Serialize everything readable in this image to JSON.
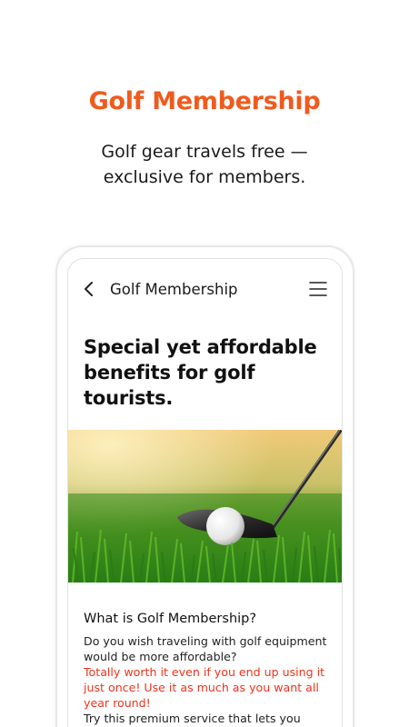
{
  "promo": {
    "title": "Golf Membership",
    "subtitle_line1": "Golf gear travels free —",
    "subtitle_line2": "exclusive for members."
  },
  "appbar": {
    "title": "Golf Membership",
    "back_icon": "chevron-left-icon",
    "menu_icon": "hamburger-menu-icon"
  },
  "content": {
    "headline": "Special yet affordable benefits for golf tourists.",
    "section_title": "What is Golf Membership?",
    "paragraph_1": "Do you wish traveling with golf equipment would be more affordable?",
    "paragraph_2_highlight": "Totally worth it even if you end up using it just once! Use it as much as you want all year round!",
    "paragraph_3": "Try this premium service that lets you check"
  },
  "colors": {
    "accent_orange": "#f05a1e",
    "highlight_red": "#f0331c",
    "text_dark": "#111111"
  }
}
